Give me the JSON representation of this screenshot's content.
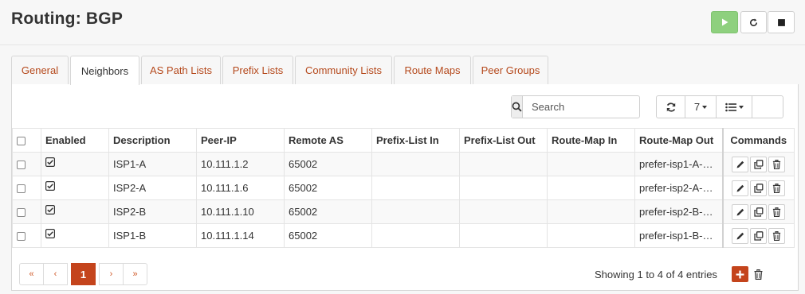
{
  "page": {
    "title": "Routing: BGP"
  },
  "service": {
    "start": "play-icon",
    "restart": "restart-icon",
    "stop": "stop-icon",
    "start_color": "#8ed07e"
  },
  "tabs": [
    {
      "label": "General",
      "active": false
    },
    {
      "label": "Neighbors",
      "active": true
    },
    {
      "label": "AS Path Lists",
      "active": false
    },
    {
      "label": "Prefix Lists",
      "active": false
    },
    {
      "label": "Community Lists",
      "active": false
    },
    {
      "label": "Route Maps",
      "active": false
    },
    {
      "label": "Peer Groups",
      "active": false
    }
  ],
  "toolbar": {
    "search_placeholder": "Search",
    "page_size": "7",
    "refresh_icon": "refresh-icon",
    "columns_icon": "list-icon"
  },
  "table": {
    "columns": [
      "Enabled",
      "Description",
      "Peer-IP",
      "Remote AS",
      "Prefix-List In",
      "Prefix-List Out",
      "Route-Map In",
      "Route-Map Out",
      "Commands"
    ],
    "rows": [
      {
        "enabled": true,
        "description": "ISP1-A",
        "peer_ip": "10.111.1.2",
        "remote_as": "65002",
        "prefix_in": "",
        "prefix_out": "",
        "routemap_in": "",
        "routemap_out": "prefer-isp1-A-m..."
      },
      {
        "enabled": true,
        "description": "ISP2-A",
        "peer_ip": "10.111.1.6",
        "remote_as": "65002",
        "prefix_in": "",
        "prefix_out": "",
        "routemap_in": "",
        "routemap_out": "prefer-isp2-A-m..."
      },
      {
        "enabled": true,
        "description": "ISP2-B",
        "peer_ip": "10.111.1.10",
        "remote_as": "65002",
        "prefix_in": "",
        "prefix_out": "",
        "routemap_in": "",
        "routemap_out": "prefer-isp2-B-m..."
      },
      {
        "enabled": true,
        "description": "ISP1-B",
        "peer_ip": "10.111.1.14",
        "remote_as": "65002",
        "prefix_in": "",
        "prefix_out": "",
        "routemap_in": "",
        "routemap_out": "prefer-isp1-B-m..."
      }
    ]
  },
  "pagination": {
    "first": "«",
    "prev": "‹",
    "current": "1",
    "next": "›",
    "last": "»",
    "info": "Showing 1 to 4 of 4 entries"
  },
  "colors": {
    "accent": "#c4441c",
    "tab_link": "#b5491c"
  }
}
